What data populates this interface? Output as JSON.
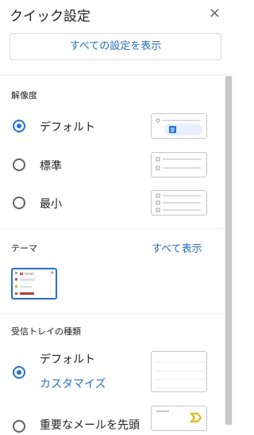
{
  "header": {
    "title": "クイック設定",
    "close_label": "×"
  },
  "show_all_settings": "すべての設定を表示",
  "density": {
    "title": "解像度",
    "options": [
      {
        "label": "デフォルト",
        "selected": true
      },
      {
        "label": "標準",
        "selected": false
      },
      {
        "label": "最小",
        "selected": false
      }
    ]
  },
  "theme": {
    "title": "テーマ",
    "view_all": "すべて表示",
    "thumb_text": "Gmail"
  },
  "inbox": {
    "title": "受信トレイの種類",
    "options": [
      {
        "label": "デフォルト",
        "customize": "カスタマイズ",
        "selected": true
      },
      {
        "label": "重要なメールを先頭",
        "selected": false
      }
    ]
  },
  "colors": {
    "accent": "#1a73e8",
    "icon_yellow": "#f4b400"
  }
}
